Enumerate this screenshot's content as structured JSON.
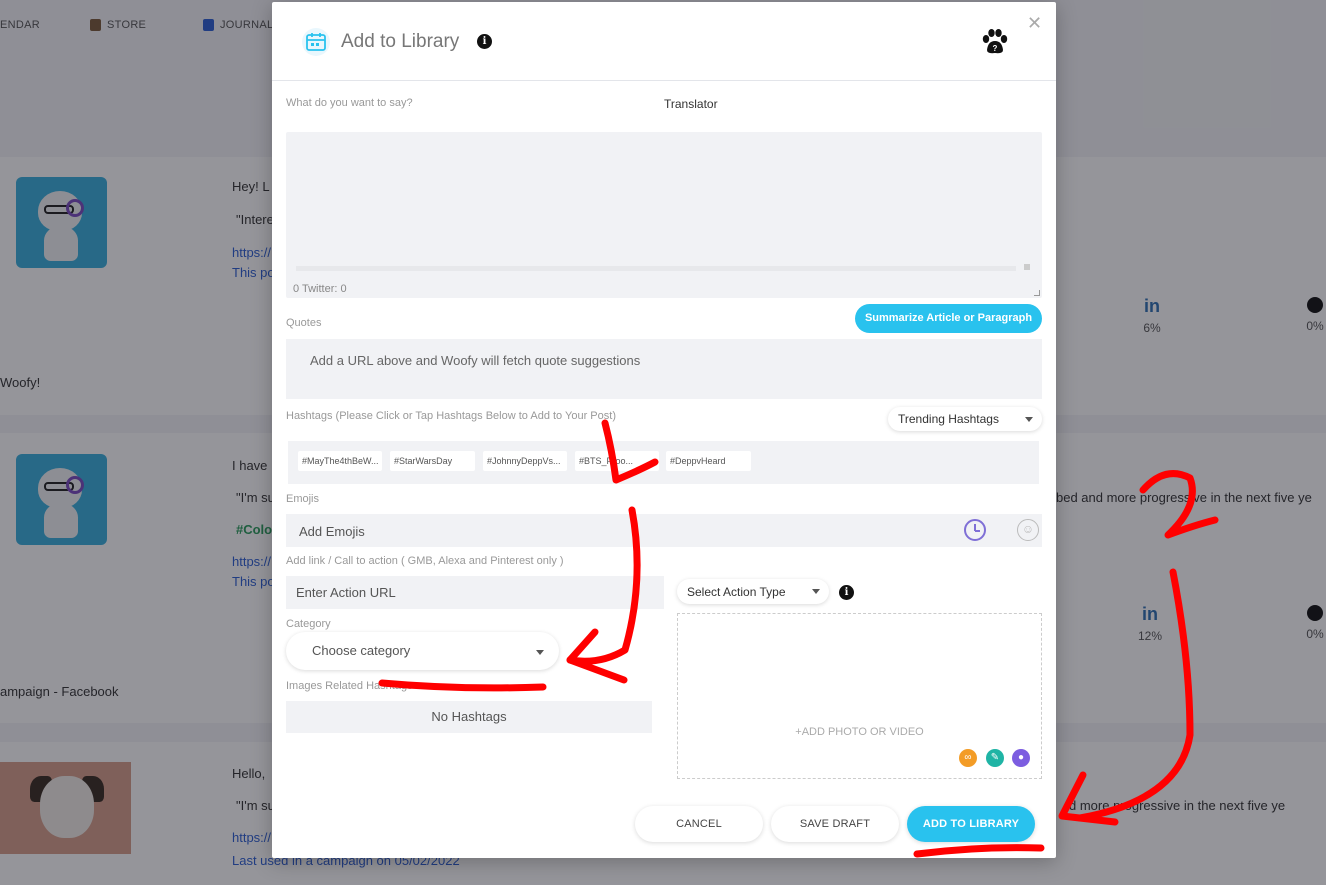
{
  "background": {
    "nav": {
      "calendar": "ENDAR",
      "store": "STORE",
      "journal": "JOURNAL"
    },
    "cards": [
      {
        "greeting": "Hey! L",
        "quote": "\"Intere",
        "link": "https://",
        "note": "This po",
        "footer": "Woofy!",
        "linkedin_pct": "6%",
        "tiktok_pct": "0%"
      },
      {
        "greeting": "I have",
        "quote": "\"I'm su",
        "quote_tail": "bed and more progressive in the next five ye",
        "hashtag": "#Colo",
        "link": "https://",
        "note": "This po",
        "footer": "ampaign - Facebook",
        "linkedin_pct": "12%",
        "tiktok_pct": "0%"
      },
      {
        "greeting": "Hello,",
        "quote": "\"I'm su",
        "quote_tail": "d more progressive in the next five ye",
        "link": "https://",
        "note": "Last used in a campaign on 05/02/2022"
      }
    ]
  },
  "modal": {
    "title": "Add to Library",
    "what_label": "What do you want to say?",
    "translator": "Translator",
    "counts": "0  Twitter: 0",
    "summarize_button": "Summarize Article or Paragraph",
    "quotes_label": "Quotes",
    "quotes_placeholder": "Add a URL above and Woofy will fetch quote suggestions",
    "hashtags_label": "Hashtags (Please Click or Tap Hashtags Below to Add to Your Post)",
    "trending_select": "Trending Hashtags",
    "tags": [
      "#MayThe4thBeW...",
      "#StarWarsDay",
      "#JohnnyDeppVs...",
      "#BTS_Proo...",
      "#DeppvHeard"
    ],
    "emojis_label": "Emojis",
    "emojis_placeholder": "Add Emojis",
    "link_label": "Add link / Call to action ( GMB, Alexa and Pinterest only )",
    "action_url_placeholder": "Enter Action URL",
    "action_type_select": "Select Action Type",
    "category_label": "Category",
    "category_select": "Choose category",
    "images_label": "Images Related Hashtags",
    "no_hashtags": "No Hashtags",
    "add_media": "+ADD PHOTO OR VIDEO",
    "cancel_button": "CANCEL",
    "save_draft_button": "SAVE DRAFT",
    "add_button": "ADD TO LIBRARY"
  },
  "annotations": {
    "one": "1",
    "two": "2"
  },
  "colors": {
    "accent": "#29c2ee",
    "annotation": "#ff0000",
    "clock": "#7f6fd6"
  }
}
